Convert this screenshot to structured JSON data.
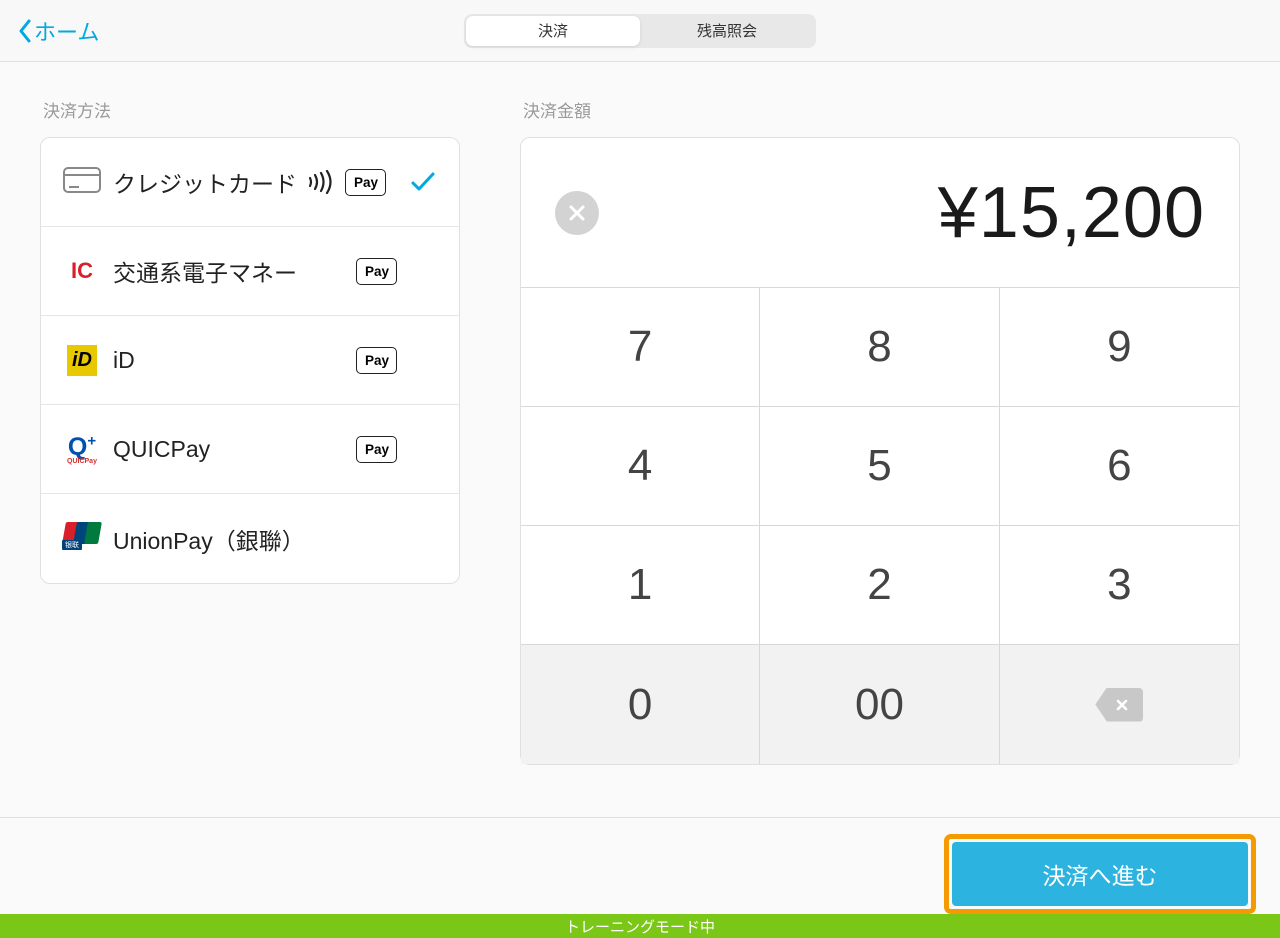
{
  "header": {
    "back_label": "ホーム",
    "tabs": [
      {
        "label": "決済"
      },
      {
        "label": "残高照会"
      }
    ]
  },
  "left": {
    "title": "決済方法",
    "methods": [
      {
        "label": "クレジットカード",
        "has_contactless": true,
        "has_applepay": true,
        "selected": true
      },
      {
        "label": "交通系電子マネー",
        "has_applepay": true
      },
      {
        "label": "iD",
        "has_applepay": true
      },
      {
        "label": "QUICPay",
        "has_applepay": true
      },
      {
        "label": "UnionPay（銀聯）"
      }
    ]
  },
  "right": {
    "title": "決済金額",
    "amount_display": "¥15,200",
    "keys": [
      "7",
      "8",
      "9",
      "4",
      "5",
      "6",
      "1",
      "2",
      "3",
      "0",
      "00"
    ]
  },
  "footer": {
    "proceed_label": "決済へ進む"
  },
  "training_label": "トレーニングモード中",
  "applepay_text": "Pay"
}
